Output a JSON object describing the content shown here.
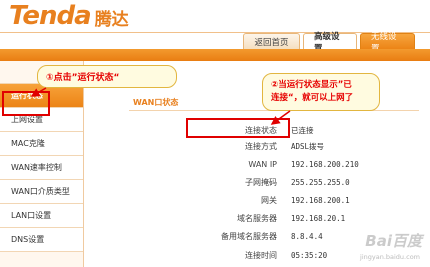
{
  "brand": {
    "logo_en": "Tenda",
    "logo_cn": "腾达"
  },
  "tabs": [
    {
      "label": "返回首页"
    },
    {
      "label": "高级设置"
    },
    {
      "label": "无线设置"
    }
  ],
  "sidebar": {
    "items": [
      {
        "label": "运行状态",
        "active": true
      },
      {
        "label": "上网设置"
      },
      {
        "label": "MAC克隆"
      },
      {
        "label": "WAN速率控制"
      },
      {
        "label": "WAN口介质类型"
      },
      {
        "label": "LAN口设置"
      },
      {
        "label": "DNS设置"
      }
    ]
  },
  "main": {
    "section_title": "WAN口状态",
    "rows": [
      {
        "label": "连接状态",
        "value": "已连接"
      },
      {
        "label": "连接方式",
        "value": "ADSL拨号"
      },
      {
        "label": "WAN IP",
        "value": "192.168.200.210"
      },
      {
        "label": "子网掩码",
        "value": "255.255.255.0"
      },
      {
        "label": "网关",
        "value": "192.168.200.1"
      },
      {
        "label": "域名服务器",
        "value": "192.168.20.1"
      },
      {
        "label": "备用域名服务器",
        "value": "8.8.4.4"
      },
      {
        "label": "连接时间",
        "value": "05:35:20"
      }
    ]
  },
  "annotations": {
    "callout1": "①点击”运行状态“",
    "callout2_line1": "②当运行状态显示”已",
    "callout2_line2": "连接“，就可以上网了",
    "color": "#e60000"
  },
  "watermark": {
    "text": "Bai百度",
    "sub": "jingyan.baidu.com"
  }
}
